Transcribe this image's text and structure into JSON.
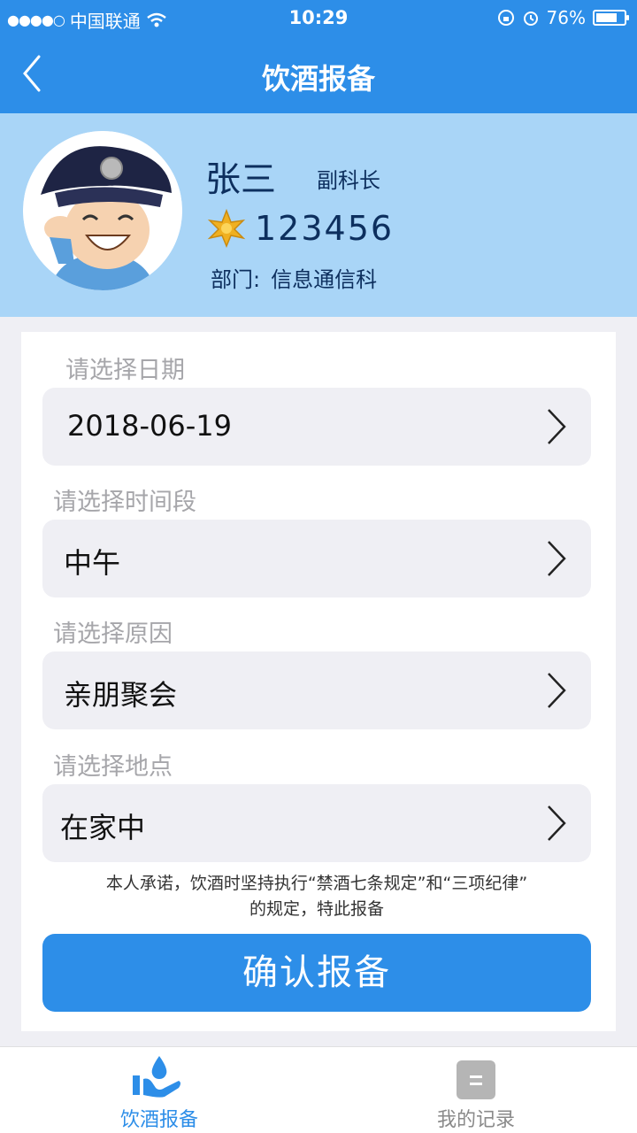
{
  "status_bar": {
    "carrier": "中国联通",
    "time": "10:29",
    "battery": "76%",
    "battery_level": 0.76
  },
  "nav": {
    "title": "饮酒报备"
  },
  "profile": {
    "name": "张三",
    "rank": "副科长",
    "badge_number": "123456",
    "department_label": "部门:",
    "department": "信息通信科"
  },
  "form": {
    "date_label": "请选择日期",
    "date_value": "2018-06-19",
    "period_label": "请选择时间段",
    "period_value": "中午",
    "reason_label": "请选择原因",
    "reason_value": "亲朋聚会",
    "location_label": "请选择地点",
    "location_value": "在家中",
    "notice_line1": "本人承诺，饮酒时坚持执行“禁酒七条规定”和“三项纪律”",
    "notice_line2": "的规定，特此报备",
    "confirm_label": "确认报备"
  },
  "tabbar": {
    "tab1_label": "饮酒报备",
    "tab2_label": "我的记录"
  },
  "colors": {
    "primary": "#2d8ee8",
    "header_bg": "#a9d5f7",
    "field_bg": "#efeff4"
  }
}
